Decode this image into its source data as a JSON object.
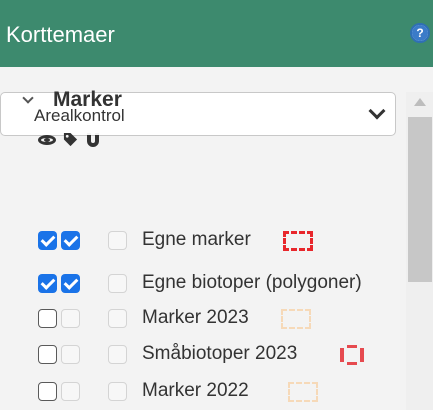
{
  "header": {
    "title": "Korttemaer"
  },
  "selector": {
    "value": "Arealkontrol"
  },
  "group": {
    "title": "Marker"
  },
  "columns": {
    "icons": [
      "eye-icon",
      "tag-icon",
      "magnet-icon"
    ]
  },
  "layers": [
    {
      "label": "Egne marker",
      "visible": true,
      "labels": true,
      "snap": false,
      "swatch": "red-dashed"
    },
    {
      "label": "Egne biotoper (polygoner)",
      "visible": true,
      "labels": true,
      "snap": false,
      "swatch": "none"
    },
    {
      "label": "Marker 2023",
      "visible": false,
      "labels": false,
      "snap": false,
      "swatch": "peach-dashed"
    },
    {
      "label": "Småbiotoper 2023",
      "visible": false,
      "labels": false,
      "snap": false,
      "swatch": "red-bracket"
    },
    {
      "label": "Marker 2022",
      "visible": false,
      "labels": false,
      "snap": false,
      "swatch": "peach-dashed"
    }
  ],
  "colors": {
    "header_bg": "#3d8a6e",
    "checkbox_checked": "#1a73e8",
    "swatch_red": "#e8262b",
    "swatch_peach": "#f6d9b8"
  }
}
